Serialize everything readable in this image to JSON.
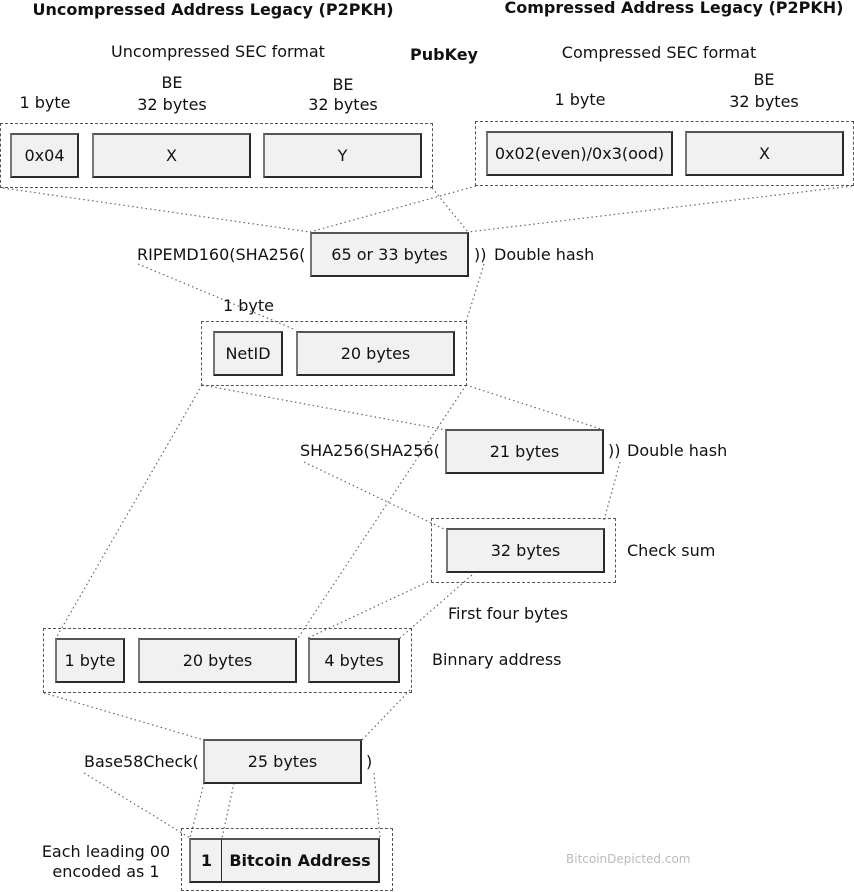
{
  "titles": {
    "uncompressed": "Uncompressed Address Legacy (P2PKH)",
    "compressed": "Compressed Address Legacy (P2PKH)",
    "pubkey": "PubKey"
  },
  "uncompressed": {
    "format": "Uncompressed SEC format",
    "fields": [
      {
        "size": "1 byte",
        "endian": "",
        "value": "0x04"
      },
      {
        "size": "32 bytes",
        "endian": "BE",
        "value": "X"
      },
      {
        "size": "32 bytes",
        "endian": "BE",
        "value": "Y"
      }
    ]
  },
  "compressed": {
    "format": "Compressed SEC format",
    "fields": [
      {
        "size": "1 byte",
        "endian": "",
        "value": "0x02(even)/0x3(ood)"
      },
      {
        "size": "32 bytes",
        "endian": "BE",
        "value": "X"
      }
    ]
  },
  "hash160": {
    "prefix": "RIPEMD160(SHA256(",
    "input": "65 or 33 bytes",
    "suffix": "))",
    "note": "Double hash"
  },
  "versioned": {
    "netid_size": "1 byte",
    "netid": "NetID",
    "payload": "20 bytes"
  },
  "checksum_hash": {
    "prefix": "SHA256(SHA256(",
    "input": "21 bytes",
    "suffix": "))",
    "note": "Double hash"
  },
  "checksum": {
    "value": "32 bytes",
    "note": "Check sum",
    "first_four": "First four bytes"
  },
  "binary": {
    "fields": [
      "1 byte",
      "20 bytes",
      "4 bytes"
    ],
    "note": "Binnary address"
  },
  "base58": {
    "prefix": "Base58Check(",
    "input": "25 bytes",
    "suffix": ")"
  },
  "address": {
    "lead": "1",
    "label": "Bitcoin Address",
    "note_line1": "Each leading 00",
    "note_line2": "encoded as 1"
  },
  "watermark": "BitcoinDepicted.com"
}
